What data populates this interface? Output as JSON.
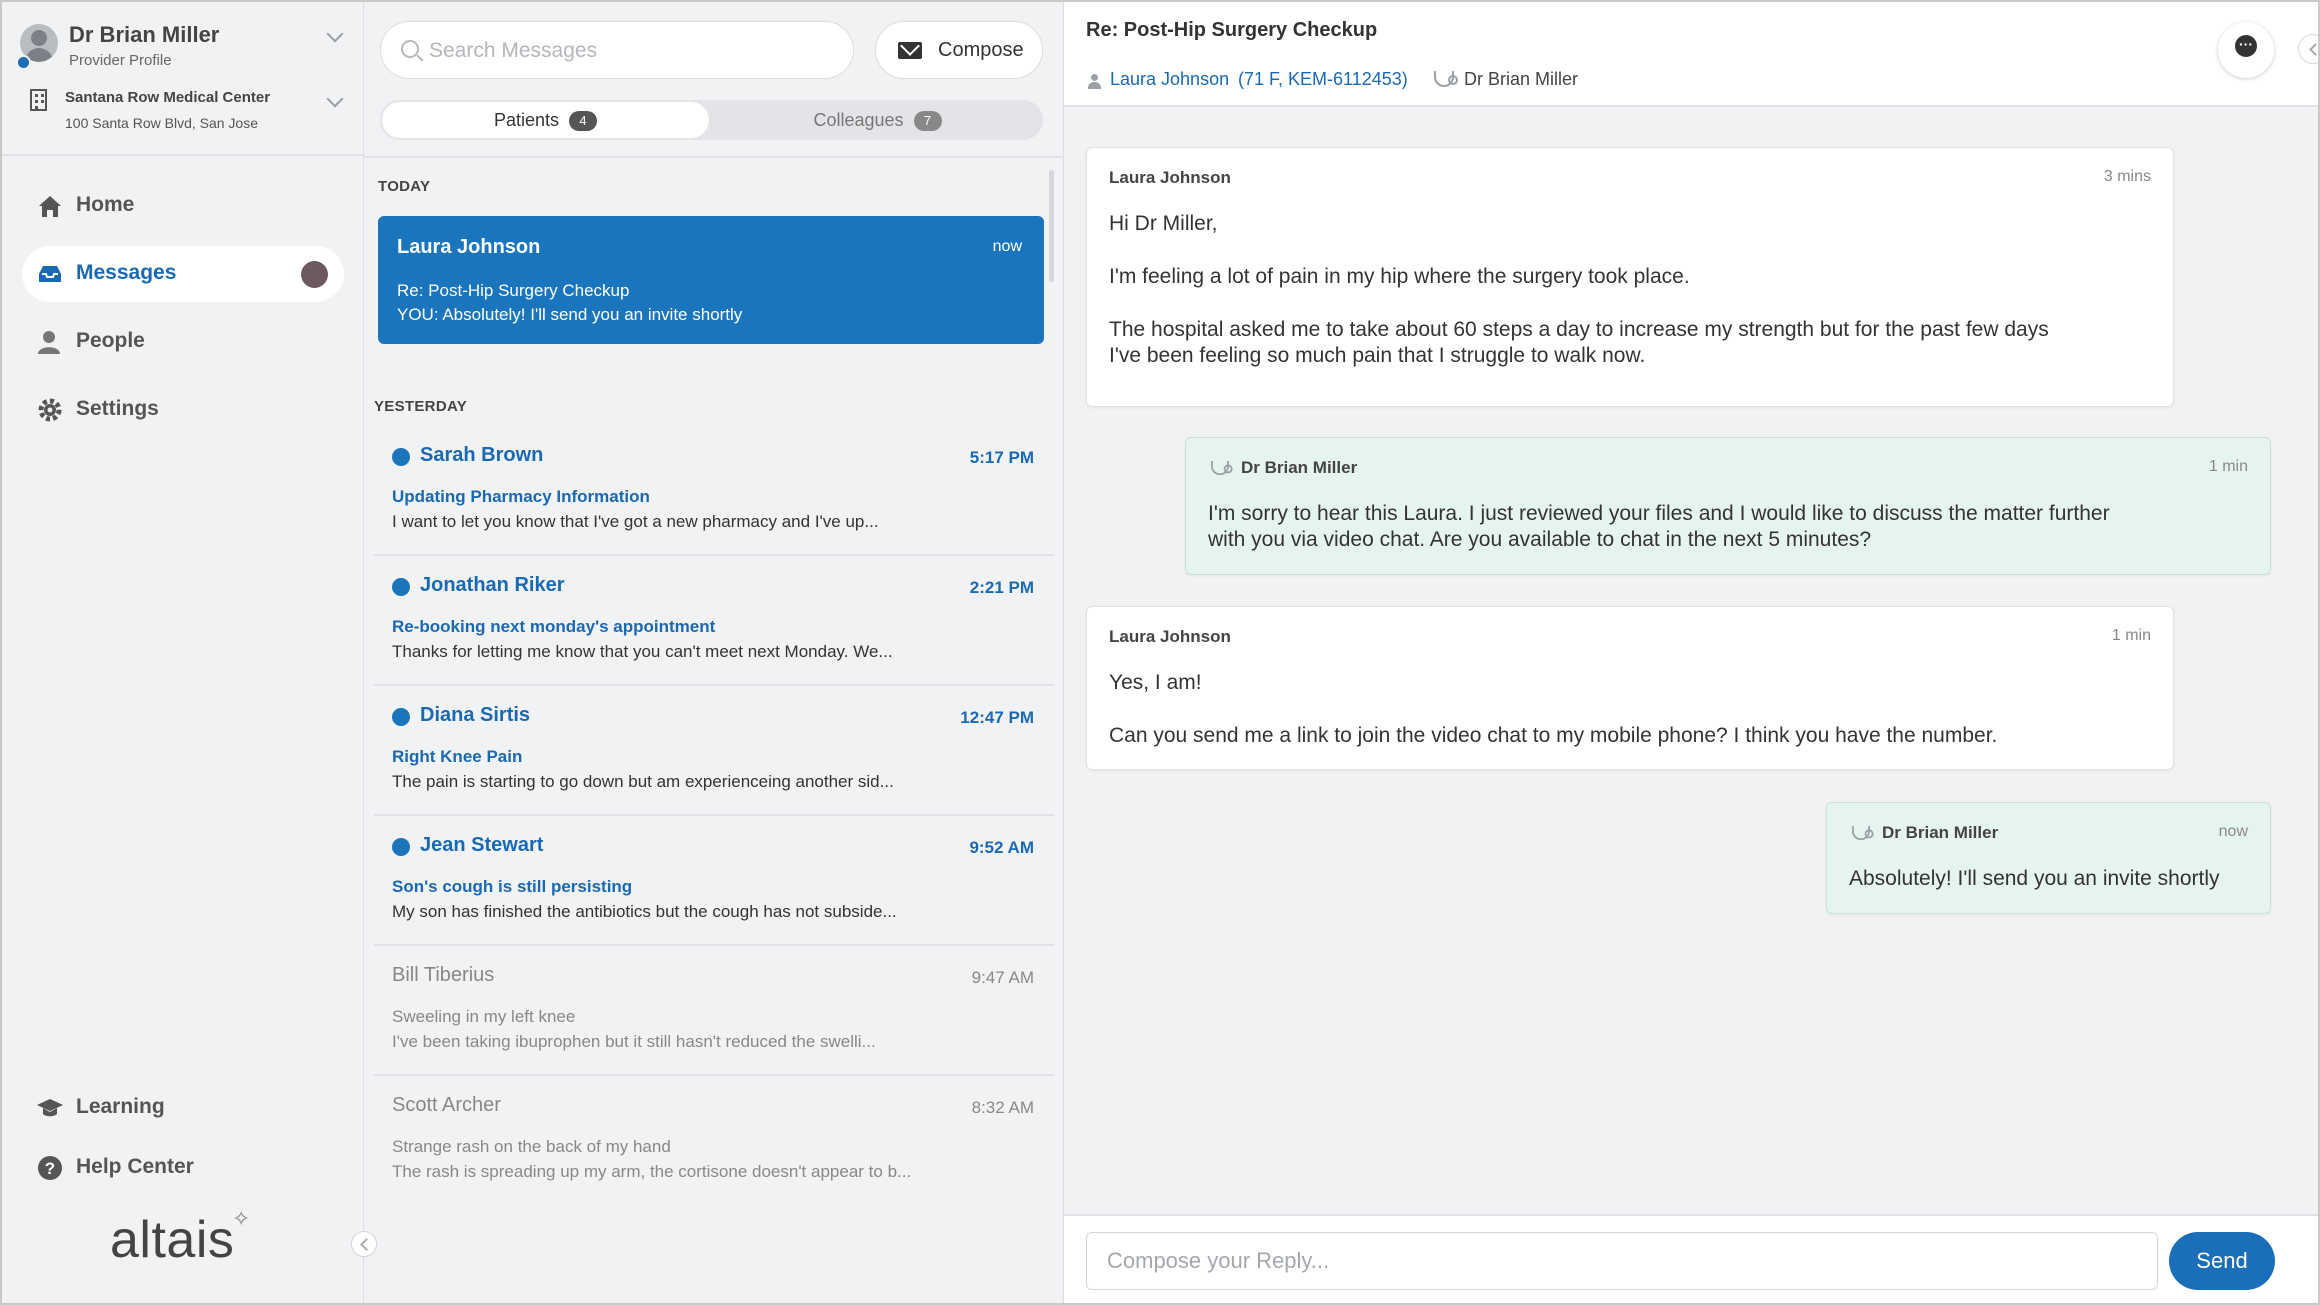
{
  "sidebar": {
    "provider_name": "Dr Brian Miller",
    "provider_sub": "Provider Profile",
    "clinic_name": "Santana Row Medical Center",
    "clinic_address": "100 Santa Row Blvd, San Jose",
    "nav": [
      {
        "label": "Home",
        "icon": "home-icon"
      },
      {
        "label": "Messages",
        "icon": "inbox-icon",
        "active": true
      },
      {
        "label": "People",
        "icon": "people-icon"
      },
      {
        "label": "Settings",
        "icon": "gear-icon"
      }
    ],
    "bottom_nav": [
      {
        "label": "Learning",
        "icon": "graduation-cap-icon"
      },
      {
        "label": "Help Center",
        "icon": "help-icon"
      }
    ],
    "logo_text": "altais"
  },
  "list": {
    "search_placeholder": "Search Messages",
    "compose_label": "Compose",
    "tabs": [
      {
        "label": "Patients",
        "count": "4",
        "active": true
      },
      {
        "label": "Colleagues",
        "count": "7"
      }
    ],
    "section_today": "TODAY",
    "section_yesterday": "YESTERDAY",
    "selected": {
      "name": "Laura Johnson",
      "time": "now",
      "subject": "Re: Post-Hip Surgery Checkup",
      "preview": "YOU:  Absolutely! I'll send you an invite shortly"
    },
    "conversations": [
      {
        "name": "Sarah Brown",
        "time": "5:17 PM",
        "subject": "Updating Pharmacy Information",
        "preview": "I want to let you know that I've got a new pharmacy and I've up...",
        "unread": true
      },
      {
        "name": "Jonathan Riker",
        "time": "2:21 PM",
        "subject": "Re-booking  next monday's appointment",
        "preview": "Thanks for letting me know that you can't meet next Monday. We...",
        "unread": true
      },
      {
        "name": "Diana Sirtis",
        "time": "12:47 PM",
        "subject": "Right Knee Pain",
        "preview": "The pain is starting to go down but am experienceing another sid...",
        "unread": true
      },
      {
        "name": "Jean Stewart",
        "time": "9:52 AM",
        "subject": "Son's cough is still persisting",
        "preview": "My son has finished the antibiotics but the cough has not subside...",
        "unread": true
      },
      {
        "name": "Bill Tiberius",
        "time": "9:47 AM",
        "subject": "Sweeling in my left knee",
        "preview": "I've been taking ibuprophen but it still hasn't reduced the swelli...",
        "unread": false
      },
      {
        "name": "Scott Archer",
        "time": "8:32 AM",
        "subject": "Strange rash on the back of my hand",
        "preview": "The rash is spreading up my arm, the cortisone doesn't appear to b...",
        "unread": false
      }
    ]
  },
  "chat": {
    "title": "Re: Post-Hip Surgery Checkup",
    "patient_name": "Laura Johnson",
    "patient_meta": "(71 F,  KEM-6112453)",
    "doctor_name": "Dr Brian Miller",
    "messages": [
      {
        "sender": "Laura Johnson",
        "time": "3 mins",
        "direction": "in",
        "lines": [
          "Hi Dr Miller,",
          "I'm feeling a lot of pain in my hip where the surgery took place.",
          "The hospital asked me to take about 60 steps a day to increase my strength but for the past few days",
          "I've been feeling so much pain that I struggle to walk now."
        ]
      },
      {
        "sender": "Dr Brian Miller",
        "time": "1 min",
        "direction": "out",
        "lines": [
          "I'm sorry to hear this Laura.  I just reviewed your files and I would like to discuss the matter further",
          "with you via video chat.  Are you available to chat in the next 5 minutes?"
        ]
      },
      {
        "sender": "Laura Johnson",
        "time": "1 min",
        "direction": "in",
        "lines": [
          "Yes, I am!",
          "Can you send me a link to join the video chat to my mobile phone?  I think you have the number."
        ]
      },
      {
        "sender": "Dr Brian Miller",
        "time": "now",
        "direction": "out",
        "lines": [
          "Absolutely! I'll send you an invite shortly"
        ]
      }
    ],
    "reply_placeholder": "Compose your Reply...",
    "send_label": "Send"
  }
}
